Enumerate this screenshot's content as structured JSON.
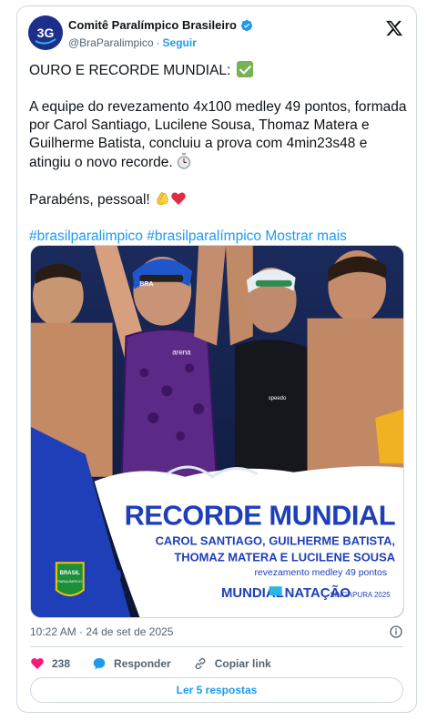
{
  "account": {
    "name": "Comitê Paralímpico Brasileiro",
    "handle": "@BraParalimpico",
    "separator": "·",
    "follow_label": "Seguir"
  },
  "post": {
    "line1": "OURO E RECORDE MUNDIAL:",
    "body": "A equipe do revezamento 4x100 medley 49 pontos, formada por Carol Santiago, Lucilene Sousa, Thomaz Matera e Guilherme Batista, concluiu a prova com 4min23s48 e atingiu o novo recorde.",
    "congrats": "Parabéns, pessoal!",
    "hashtags": [
      "#brasilparalimpico",
      "#brasilparalímpico"
    ],
    "show_more": "Mostrar mais"
  },
  "media": {
    "headline": "RECORDE MUNDIAL",
    "names_line1": "CAROL SANTIAGO, GUILHERME BATISTA,",
    "names_line2": "THOMAZ MATERA E LUCILENE SOUSA",
    "event": "revezamento medley 49 pontos",
    "brand_left": "MUNDIAL",
    "brand_right": "NATAÇÃO",
    "brand_location": "SINGAPURA 2025",
    "logo_brasil": "BRASIL",
    "logo_brasil_sub": "PARALÍMPICO",
    "logo_30": "30",
    "logo_30_sub1": "COMITÊ",
    "logo_30_sub2": "PARALÍMPICO",
    "logo_30_sub3": "BRASILEIRO",
    "cap_text": "BRA",
    "suit_brand_1": "arena",
    "suit_brand_2": "speedo",
    "accent_blue": "#1f3fb8",
    "accent_yellow": "#f4c400"
  },
  "meta": {
    "time": "10:22 AM",
    "separator": "·",
    "date": "24 de set de 2025"
  },
  "actions": {
    "likes": "238",
    "reply_label": "Responder",
    "copy_label": "Copiar link"
  },
  "replies_button": "Ler 5 respostas"
}
